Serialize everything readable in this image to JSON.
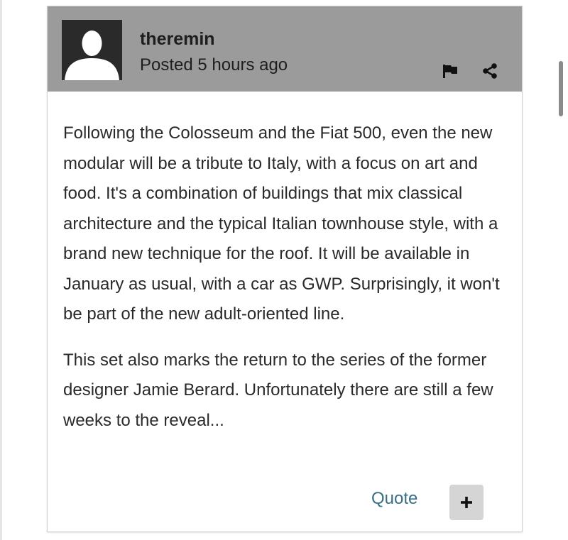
{
  "post": {
    "author": "theremin",
    "posted": "Posted 5 hours ago",
    "paragraphs": [
      "Following the Colosseum and the Fiat 500, even the new modular will be a tribute to Italy, with a focus on art and food. It's a combination of buildings that mix classical architecture and the typical Italian townhouse style, with a brand new technique for the roof. It will be available in January as usual, with a car as GWP. Surprisingly, it won't be part of the new adult-oriented line.",
      "This set also marks the return to the series of the former designer Jamie Berard. Unfortunately there are still a few weeks to the reveal..."
    ],
    "quote_label": "Quote",
    "expand_label": "+"
  },
  "icons": {
    "avatar": "default-user-silhouette",
    "report": "flag-icon",
    "share": "share-icon"
  },
  "colors": {
    "header_bg": "#9b9b9b",
    "avatar_bg": "#2a2a2a",
    "link": "#3a6f85",
    "button_bg": "#d5d5d5",
    "text": "#2a2a2a"
  }
}
